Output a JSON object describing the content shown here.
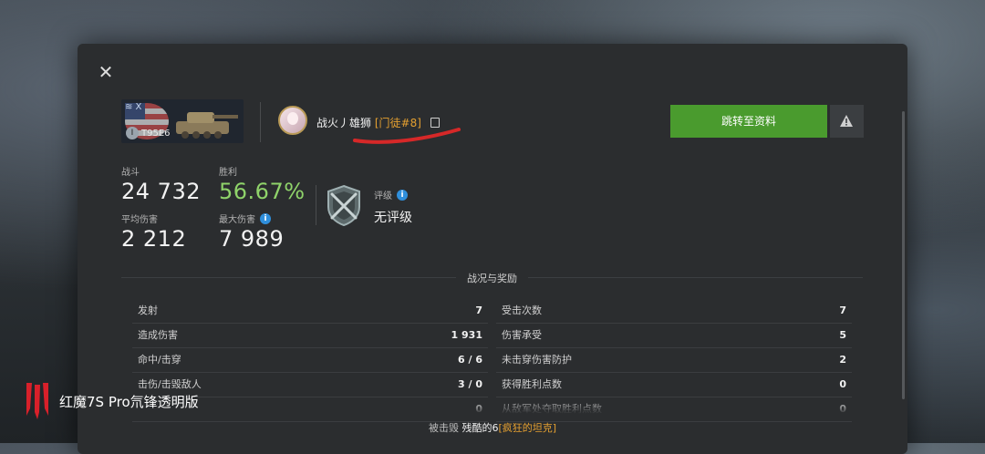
{
  "close_label": "✕",
  "tank": {
    "name": "T95E6",
    "tier": "Ⅰ",
    "class_marker": "≋ X"
  },
  "player": {
    "name": "战火丿雄狮",
    "clan": "[门徒#8]"
  },
  "buttons": {
    "jump": "跳转至资料",
    "report_icon": "warning-icon"
  },
  "stats": {
    "battles": {
      "label": "战斗",
      "value": "24 732"
    },
    "winrate": {
      "label": "胜利",
      "value": "56.67%",
      "color": "#8fd36a"
    },
    "avg_damage": {
      "label": "平均伤害",
      "value": "2 212"
    },
    "max_damage": {
      "label": "最大伤害",
      "value": "7 989"
    }
  },
  "rating": {
    "label": "评级",
    "value": "无评级"
  },
  "section": {
    "title": "战况与奖励"
  },
  "left_rows": [
    {
      "k": "发射",
      "v": "7"
    },
    {
      "k": "造成伤害",
      "v": "1 931"
    },
    {
      "k": "命中/击穿",
      "v": "6 / 6"
    },
    {
      "k": "击伤/击毁敌人",
      "v": "3 / 0"
    },
    {
      "k": "",
      "v": "0"
    }
  ],
  "right_rows": [
    {
      "k": "受击次数",
      "v": "7"
    },
    {
      "k": "伤害承受",
      "v": "5"
    },
    {
      "k": "未击穿伤害防护",
      "v": "2"
    },
    {
      "k": "获得胜利点数",
      "v": "0"
    },
    {
      "k": "从敌军处夺取胜利点数",
      "v": "0"
    }
  ],
  "destroyed_by": {
    "prefix": "被击毁",
    "name": "残酷的6",
    "clan": "[疯狂的坦克]"
  },
  "watermark": {
    "text": "红魔7S Pro氘锋透明版"
  },
  "colors": {
    "accent_green": "#4a9b2e",
    "clan_orange": "#e5a030",
    "annotation_red": "#d62828"
  }
}
